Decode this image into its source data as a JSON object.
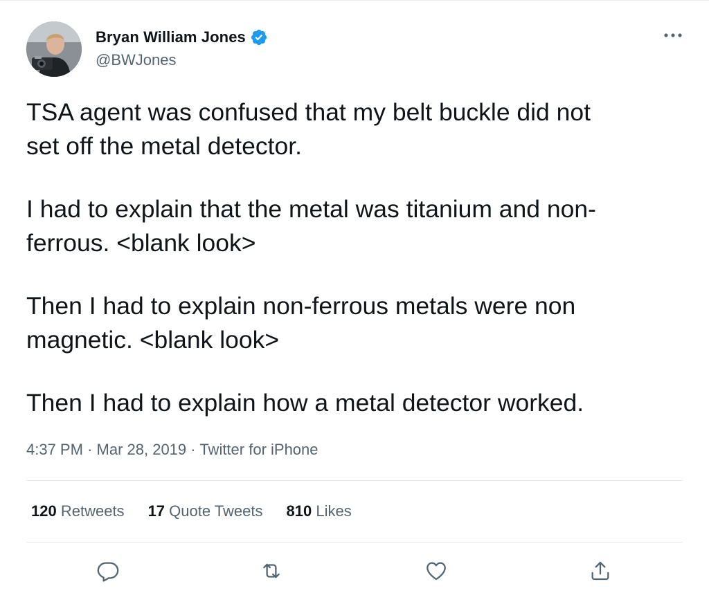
{
  "tweet": {
    "author": {
      "display_name": "Bryan William Jones",
      "handle": "@BWJones",
      "verified": true,
      "avatar_icon": "profile-photo"
    },
    "paragraphs": [
      "TSA agent was confused that my belt buckle did not\nset off the metal detector.",
      "I had to explain that the metal was titanium and non-\nferrous. <blank look>",
      "Then I had to explain non-ferrous metals were non\nmagnetic. <blank look>",
      "Then I had to explain how a metal detector worked."
    ],
    "time": "4:37 PM",
    "separator": "·",
    "date": "Mar 28, 2019",
    "source": "Twitter for iPhone"
  },
  "stats": {
    "retweets_count": "120",
    "retweets_label": "Retweets",
    "quotes_count": "17",
    "quotes_label": "Quote Tweets",
    "likes_count": "810",
    "likes_label": "Likes"
  },
  "actions": {
    "reply_icon": "speech-bubble-icon",
    "retweet_icon": "retweet-arrows-icon",
    "like_icon": "heart-icon",
    "share_icon": "share-upload-icon"
  },
  "colors": {
    "text_primary": "#0f1419",
    "text_secondary": "#536471",
    "verified_blue": "#1d9bf0",
    "divider": "#e6e9eb"
  }
}
